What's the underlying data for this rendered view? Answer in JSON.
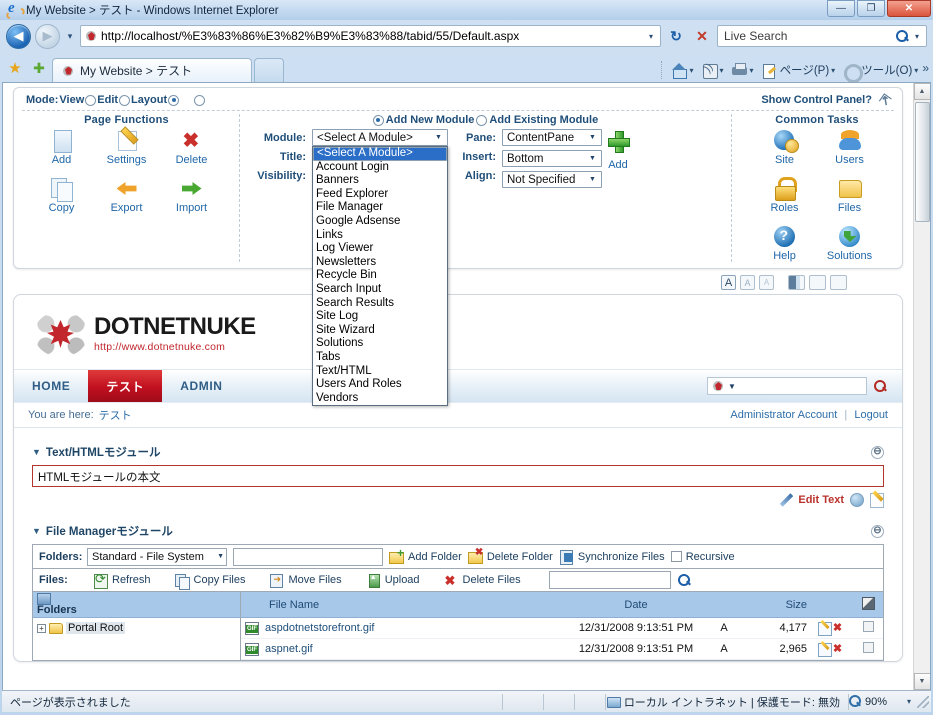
{
  "window": {
    "title": "My Website > テスト - Windows Internet Explorer",
    "minimize": "—",
    "maximize": "❐",
    "close": "✕"
  },
  "address": {
    "url": "http://localhost/%E3%83%86%E3%82%B9%E3%83%88/tabid/55/Default.aspx",
    "refresh_icon": "↻",
    "stop_icon": "✕",
    "search_placeholder": "Live Search",
    "search_value": "Live Search"
  },
  "tabbar": {
    "favorites_icon": "★",
    "add_favorites_icon": "✚",
    "tab_label": "My Website > テスト",
    "commands": [
      {
        "label": "",
        "icon": "home-icon"
      },
      {
        "label": "",
        "icon": "rss-icon"
      },
      {
        "label": "",
        "icon": "print-icon"
      },
      {
        "label": "ページ(P)",
        "icon": "page-icon"
      },
      {
        "label": "ツール(O)",
        "icon": "tools-gear-icon"
      }
    ],
    "overflow": "»"
  },
  "control_panel": {
    "mode_label": "Mode:",
    "mode_options": [
      "View",
      "Edit",
      "Layout"
    ],
    "mode_selected": "Layout",
    "show_control_panel": "Show Control Panel?",
    "page_functions_title": "Page Functions",
    "page_functions": [
      {
        "label": "Add",
        "icon": "add-page-icon"
      },
      {
        "label": "Settings",
        "icon": "settings-pencil-icon"
      },
      {
        "label": "Delete",
        "icon": "delete-x-icon"
      },
      {
        "label": "Copy",
        "icon": "copy-page-icon"
      },
      {
        "label": "Export",
        "icon": "export-arrow-icon"
      },
      {
        "label": "Import",
        "icon": "import-arrow-icon"
      }
    ],
    "add_new_module": "Add New Module",
    "add_existing_module": "Add Existing Module",
    "fields": {
      "module_label": "Module:",
      "module_value": "<Select A Module>",
      "title_label": "Title:",
      "title_value": "",
      "visibility_label": "Visibility:",
      "pane_label": "Pane:",
      "pane_value": "ContentPane",
      "insert_label": "Insert:",
      "insert_value": "Bottom",
      "align_label": "Align:",
      "align_value": "Not Specified",
      "add_label": "Add"
    },
    "module_options": [
      "<Select A Module>",
      "Account Login",
      "Banners",
      "Feed Explorer",
      "File Manager",
      "Google Adsense",
      "Links",
      "Log Viewer",
      "Newsletters",
      "Recycle Bin",
      "Search Input",
      "Search Results",
      "Site Log",
      "Site Wizard",
      "Solutions",
      "Tabs",
      "Text/HTML",
      "Users And Roles",
      "Vendors"
    ],
    "common_tasks_title": "Common Tasks",
    "common_tasks": [
      {
        "label": "Site",
        "icon": "site-globe-icon"
      },
      {
        "label": "Users",
        "icon": "users-icon"
      },
      {
        "label": "Roles",
        "icon": "roles-lock-icon"
      },
      {
        "label": "Files",
        "icon": "files-folder-icon"
      },
      {
        "label": "Help",
        "icon": "help-icon"
      },
      {
        "label": "Solutions",
        "icon": "solutions-icon"
      }
    ]
  },
  "skin_tools": {
    "font_sizes": [
      "A",
      "A",
      "A"
    ],
    "layouts": [
      "layout-1",
      "layout-2",
      "layout-3"
    ]
  },
  "site": {
    "logo_word": "DOTNETNUKE",
    "logo_url": "http://www.dotnetnuke.com",
    "nav": [
      {
        "label": "HOME",
        "active": false
      },
      {
        "label": "テスト",
        "active": true
      },
      {
        "label": "ADMIN",
        "active": false
      }
    ],
    "search_value": "",
    "breadcrumb_prefix": "You are here:",
    "breadcrumb_current": "テスト",
    "account_label": "Administrator Account",
    "account_sep": "|",
    "logout_label": "Logout"
  },
  "modules": {
    "text_html": {
      "title": "Text/HTMLモジュール",
      "collapse_icon": "⊖",
      "body": "HTMLモジュールの本文",
      "edit_text_label": "Edit Text"
    },
    "file_manager": {
      "title": "File Managerモジュール",
      "collapse_icon": "⊖",
      "folders_label": "Folders:",
      "folders_value": "Standard - File System",
      "folder_path_value": "",
      "add_folder": "Add Folder",
      "delete_folder": "Delete Folder",
      "synchronize_files": "Synchronize Files",
      "recursive": "Recursive",
      "files_label": "Files:",
      "refresh": "Refresh",
      "copy_files": "Copy Files",
      "move_files": "Move Files",
      "upload": "Upload",
      "delete_files": "Delete Files",
      "filter_value": "",
      "tree_header": "Folders",
      "tree_root": "Portal Root",
      "tree_expand": "+",
      "columns": {
        "name": "File Name",
        "date": "Date",
        "size": "Size"
      },
      "rows": [
        {
          "name": "aspdotnetstorefront.gif",
          "date": "12/31/2008 9:13:51 PM",
          "attr": "A",
          "size": "4,177",
          "edit_icon": "edit-icon",
          "delete_icon": "delete-icon"
        },
        {
          "name": "aspnet.gif",
          "date": "12/31/2008 9:13:51 PM",
          "attr": "A",
          "size": "2,965",
          "edit_icon": "edit-icon",
          "delete_icon": "delete-icon"
        }
      ]
    }
  },
  "statusbar": {
    "message": "ページが表示されました",
    "zone": "ローカル イントラネット | 保護モード: 無効",
    "zoom": "90%",
    "zoom_caret": "▾"
  }
}
